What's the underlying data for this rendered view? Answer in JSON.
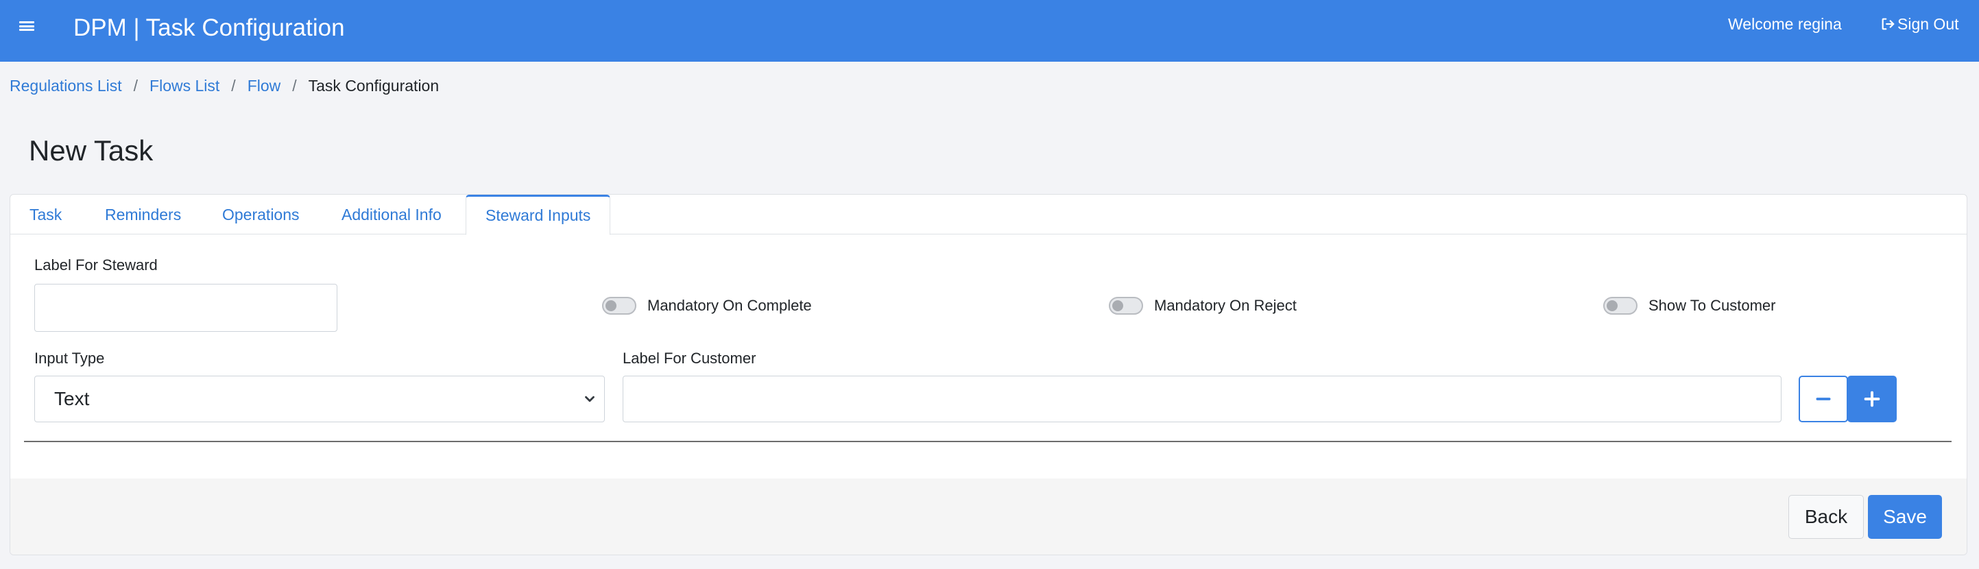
{
  "header": {
    "title": "DPM | Task Configuration",
    "welcome": "Welcome regina",
    "sign_out": "Sign Out",
    "menu_icon": "hamburger-icon",
    "sign_out_icon": "sign-out-icon",
    "bar_color": "#3a82e4"
  },
  "breadcrumb": {
    "items": [
      "Regulations List",
      "Flows List",
      "Flow",
      "Task Configuration"
    ],
    "separator": "/"
  },
  "page": {
    "title": "New Task"
  },
  "tabs": {
    "items": [
      "Task",
      "Reminders",
      "Operations",
      "Additional Info",
      "Steward Inputs"
    ],
    "active": "Steward Inputs"
  },
  "steward_inputs": {
    "label_for_steward": {
      "label": "Label For Steward",
      "value": ""
    },
    "mandatory_on_complete": {
      "label": "Mandatory On Complete",
      "checked": false
    },
    "mandatory_on_reject": {
      "label": "Mandatory On Reject",
      "checked": false
    },
    "show_to_customer": {
      "label": "Show To Customer",
      "checked": false
    },
    "input_type": {
      "label": "Input Type",
      "value": "Text"
    },
    "label_for_customer": {
      "label": "Label For Customer",
      "value": ""
    },
    "remove_icon": "minus-icon",
    "add_icon": "plus-icon"
  },
  "footer": {
    "back_label": "Back",
    "save_label": "Save"
  }
}
